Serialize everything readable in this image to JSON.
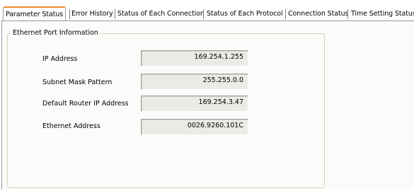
{
  "tabs": [
    {
      "label": "Parameter Status",
      "active": true
    },
    {
      "label": "Error History",
      "active": false
    },
    {
      "label": "Status of Each Connection",
      "active": false
    },
    {
      "label": "Status of Each Protocol",
      "active": false
    },
    {
      "label": "Connection Status",
      "active": false
    },
    {
      "label": "Time Setting Status",
      "active": false
    }
  ],
  "group": {
    "title": "Ethernet Port Information",
    "fields": [
      {
        "label": "IP Address",
        "value": "169.254.1.255"
      },
      {
        "label": "Subnet Mask Pattern",
        "value": "255.255.0.0"
      },
      {
        "label": "Default Router IP Address",
        "value": "169.254.3.47"
      },
      {
        "label": "Ethernet Address",
        "value": "0026.9260.101C"
      }
    ]
  },
  "colors": {
    "active_tab_accent": "#e68b2c",
    "panel_background": "#fbfbf9",
    "readonly_field_background": "#ebeae6"
  }
}
